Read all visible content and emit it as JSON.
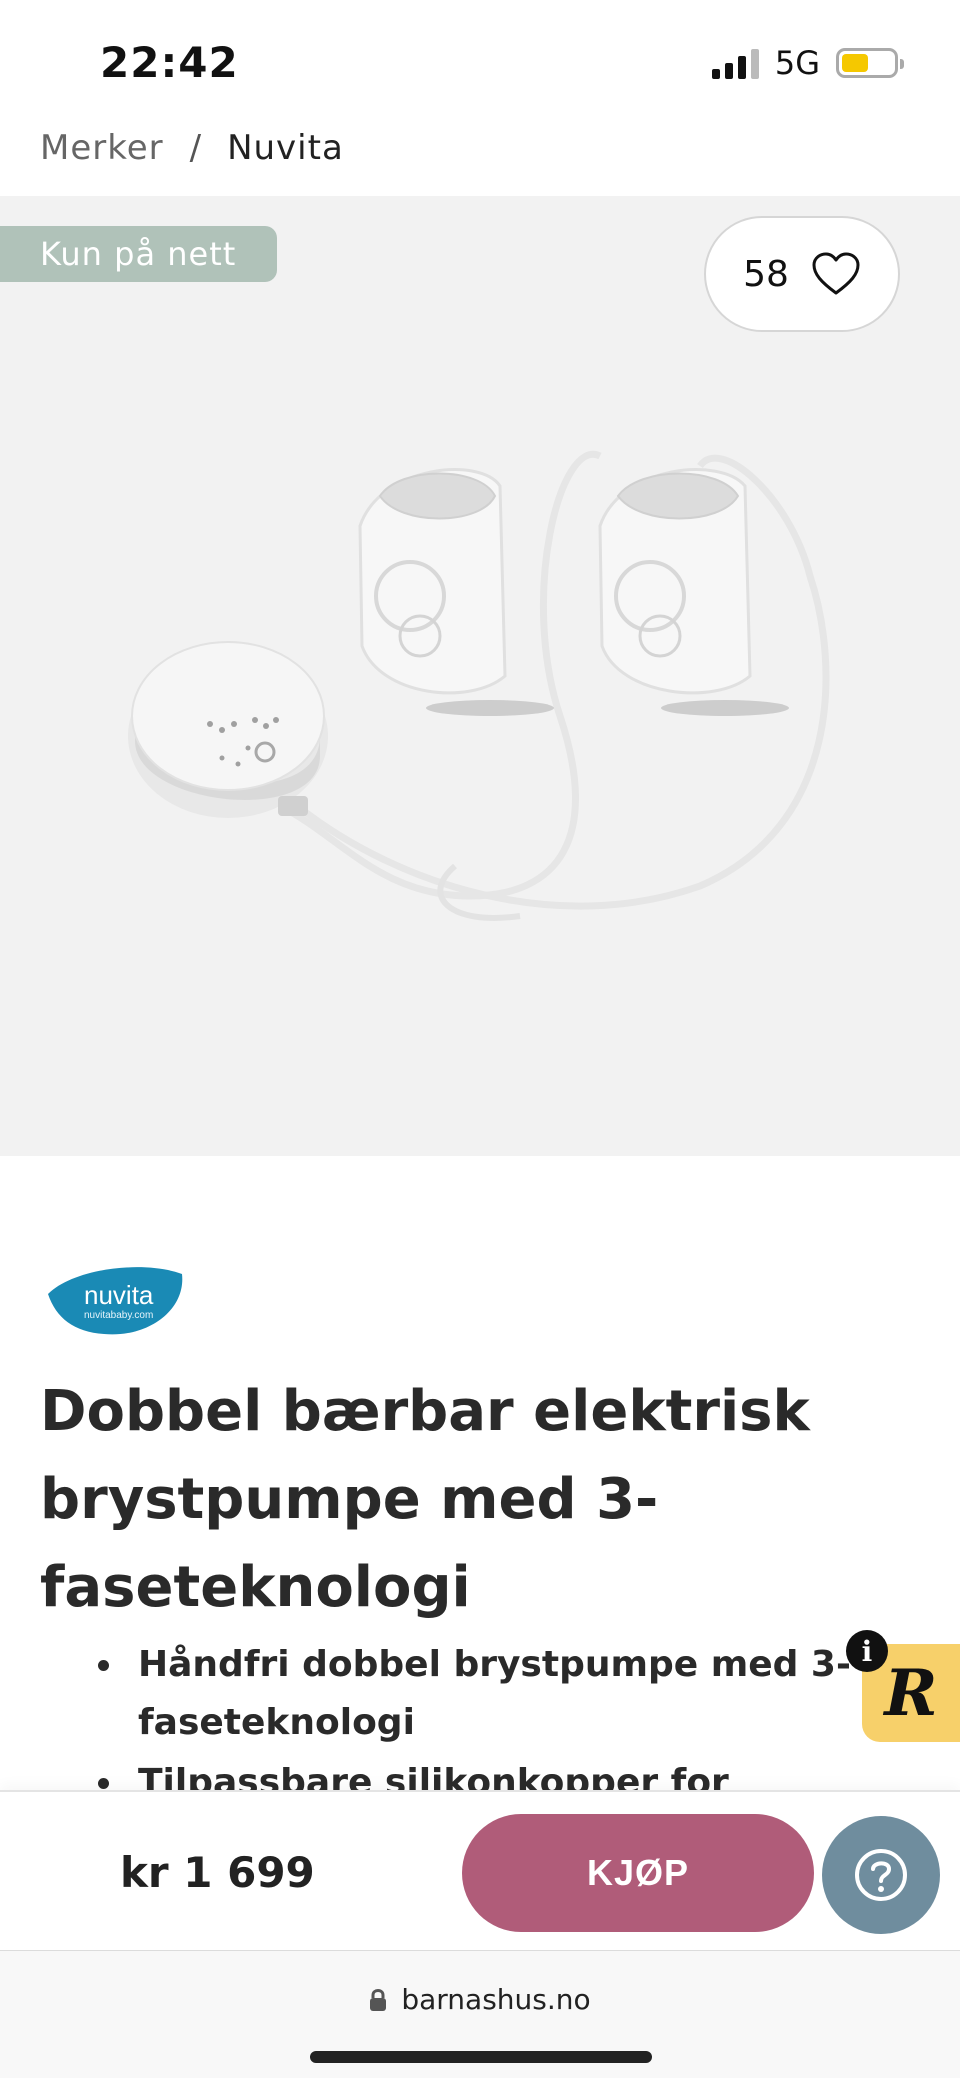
{
  "status": {
    "time": "22:42",
    "network": "5G"
  },
  "breadcrumb": {
    "items": [
      "Merker",
      "Nuvita"
    ],
    "separator": "/"
  },
  "product": {
    "badge": "Kun på nett",
    "favorites_count": "58",
    "brand_logo_text": "nuvita",
    "brand_logo_subtext": "nuvitababy.com",
    "title": "Dobbel bærbar elektrisk brystpumpe med 3-faseteknologi",
    "bullets": [
      "Håndfri dobbel brystpumpe med 3-faseteknologi",
      "Tilpassbare silikonkopper for komfort"
    ]
  },
  "buy_bar": {
    "price": "kr 1 699",
    "buy_label": "KJØP"
  },
  "url_bar": {
    "domain": "barnashus.no"
  },
  "colors": {
    "badge": "#b0c2b9",
    "buy_button": "#b05c79",
    "help_button": "#6f8d9e",
    "widget": "#f7d06a",
    "brand": "#1a8ab5"
  },
  "icons": [
    "heart-icon",
    "help-icon",
    "lock-icon",
    "info-icon",
    "r-widget-icon"
  ]
}
